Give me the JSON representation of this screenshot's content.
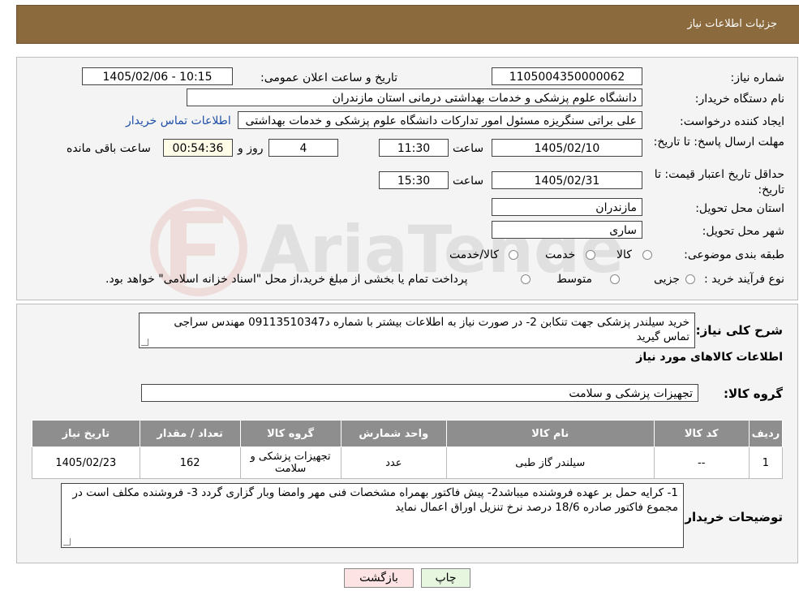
{
  "header": {
    "title": "جزئیات اطلاعات نیاز"
  },
  "form": {
    "need_number_label": "شماره نیاز:",
    "need_number": "1105004350000062",
    "announce_label": "تاریخ و ساعت اعلان عمومی:",
    "announce_value": "1405/02/06 - 10:15",
    "buyer_org_label": "نام دستگاه خریدار:",
    "buyer_org": "دانشگاه علوم پزشکی و خدمات بهداشتی  درمانی استان مازندران",
    "creator_label": "ایجاد کننده درخواست:",
    "creator": "علی براتی سنگریزه مسئول امور تدارکات دانشگاه علوم پزشکی و خدمات بهداشتی",
    "contact_link": "اطلاعات تماس خریدار",
    "deadline_label": "مهلت ارسال پاسخ: تا تاریخ:",
    "deadline_date": "1405/02/10",
    "deadline_time_label": "ساعت",
    "deadline_time": "11:30",
    "days_value": "4",
    "days_label": "روز و",
    "remaining_time": "00:54:36",
    "remaining_label": "ساعت باقی مانده",
    "validity_label": "حداقل تاریخ اعتبار قیمت: تا تاریخ:",
    "validity_date": "1405/02/31",
    "validity_time_label": "ساعت",
    "validity_time": "15:30",
    "province_label": "استان محل تحویل:",
    "province": "مازندران",
    "city_label": "شهر محل تحویل:",
    "city": "ساری",
    "category_label": "طبقه بندی موضوعی:",
    "category_options": [
      "کالا",
      "خدمت",
      "کالا/خدمت"
    ],
    "process_label": "نوع فرآیند خرید :",
    "process_options": [
      "جزیی",
      "متوسط"
    ],
    "process_note": "پرداخت تمام یا بخشی از مبلغ خرید،از محل \"اسناد خزانه اسلامی\" خواهد بود."
  },
  "details": {
    "summary_label": "شرح کلی نیاز:",
    "summary_text": "خرید سیلندر پزشکی جهت تنکابن 2- در صورت نیاز به اطلاعات بیشتر با شماره د09113510347 مهندس سراجی تماس گیرید",
    "goods_info_title": "اطلاعات کالاهای مورد نیاز",
    "goods_group_label": "گروه کالا:",
    "goods_group": "تجهیزات پزشکی و سلامت",
    "table": {
      "headers": [
        "ردیف",
        "کد کالا",
        "نام کالا",
        "واحد شمارش",
        "گروه کالا",
        "تعداد / مقدار",
        "تاریخ نیاز"
      ],
      "rows": [
        [
          "1",
          "--",
          "سیلندر گاز طبی",
          "عدد",
          "تجهیزات پزشکی و سلامت",
          "162",
          "1405/02/23"
        ]
      ]
    },
    "buyer_notes_label": "توضیحات خریدار:",
    "buyer_notes": "1- کرایه حمل بر  عهده فروشنده میباشد2- پیش فاکتور بهمراه مشخصات فنی مهر وامضا وبار گزاری گردد 3- فروشنده مکلف است در مجموع فاکتور صادره 18/6 درصد نرخ تنزیل اوراق اعمال نماید"
  },
  "buttons": {
    "print": "چاپ",
    "back": "بازگشت"
  },
  "colors": {
    "header_bg": "#8b6b3e",
    "link": "#1e4fa6",
    "back_btn_bg": "#fde3e3",
    "print_btn_bg": "#e6f6df"
  }
}
